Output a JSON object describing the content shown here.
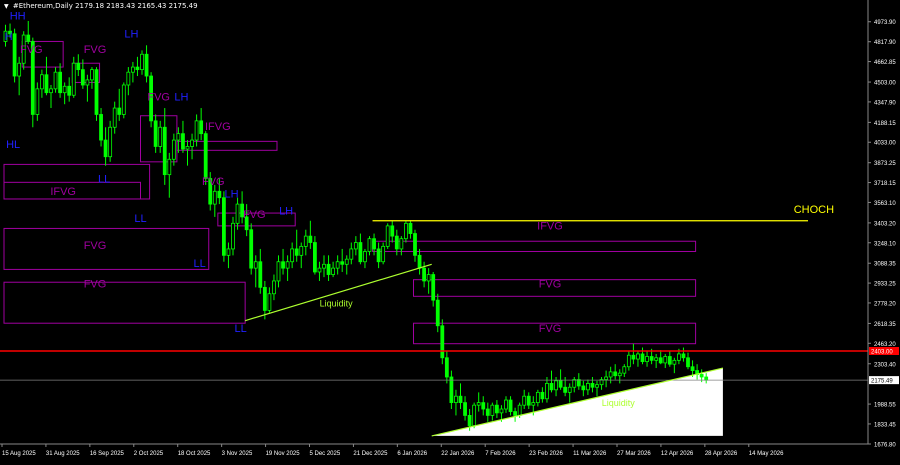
{
  "window": {
    "symbol_label": "#Ethereum,Daily",
    "ohlc_label": "2179.18 2183.43 2165.43 2175.49",
    "dropdown_icon": "triangle-down-icon"
  },
  "colors": {
    "background": "#000000",
    "bull_candle": "#00ff00",
    "bear_candle": "#00ff00",
    "zone_border": "#a000a0",
    "zone_label": "#a000a0",
    "structure_label": "#2020ff",
    "liquidity_line": "#adff2f",
    "choch_color": "#ffff00",
    "key_level": "#ff0000",
    "current_price_line": "#808080",
    "axis_text": "#ffffff"
  },
  "chart_data": {
    "type": "candlestick",
    "title": "#Ethereum,Daily",
    "ylim": [
      1676.8,
      5050
    ],
    "x_ticks": [
      "15 Aug 2025",
      "31 Aug 2025",
      "16 Sep 2025",
      "2 Oct 2025",
      "18 Oct 2025",
      "3 Nov 2025",
      "19 Nov 2025",
      "5 Dec 2025",
      "21 Dec 2025",
      "6 Jan 2026",
      "22 Jan 2026",
      "7 Feb 2026",
      "23 Feb 2026",
      "11 Mar 2026",
      "27 Mar 2026",
      "12 Apr 2026",
      "28 Apr 2026",
      "14 May 2026"
    ],
    "y_ticks": [
      "4973.90",
      "4817.90",
      "4662.85",
      "4503.00",
      "4347.90",
      "4188.15",
      "4033.00",
      "3873.25",
      "3718.15",
      "3563.10",
      "3403.20",
      "3248.10",
      "3088.35",
      "2933.25",
      "2778.20",
      "2618.35",
      "2463.20",
      "2303.40",
      "1988.55",
      "1833.45",
      "1676.80"
    ],
    "current_price": "2175.49",
    "key_level_price": "2403.00",
    "key_level_label": "2403.00",
    "series": [
      {
        "values": [
          [
            4820,
            4950,
            4780,
            4900
          ],
          [
            4900,
            4960,
            4850,
            4880
          ],
          [
            4880,
            4920,
            4500,
            4550
          ],
          [
            4550,
            4700,
            4400,
            4650
          ],
          [
            4650,
            4900,
            4600,
            4870
          ],
          [
            4870,
            4980,
            4800,
            4820
          ],
          [
            4820,
            4850,
            4150,
            4250
          ],
          [
            4250,
            4500,
            4200,
            4450
          ],
          [
            4450,
            4600,
            4380,
            4560
          ],
          [
            4560,
            4700,
            4400,
            4420
          ],
          [
            4420,
            4480,
            4300,
            4450
          ],
          [
            4450,
            4620,
            4420,
            4580
          ],
          [
            4580,
            4650,
            4380,
            4420
          ],
          [
            4420,
            4500,
            4330,
            4470
          ],
          [
            4470,
            4540,
            4350,
            4400
          ],
          [
            4400,
            4700,
            4380,
            4650
          ],
          [
            4650,
            4720,
            4550,
            4600
          ],
          [
            4600,
            4680,
            4450,
            4480
          ],
          [
            4480,
            4560,
            4350,
            4520
          ],
          [
            4520,
            4620,
            4450,
            4600
          ],
          [
            4600,
            4620,
            4200,
            4250
          ],
          [
            4250,
            4300,
            4000,
            4050
          ],
          [
            4050,
            4150,
            3850,
            3920
          ],
          [
            3920,
            4200,
            3880,
            4150
          ],
          [
            4150,
            4350,
            4100,
            4300
          ],
          [
            4300,
            4450,
            4200,
            4250
          ],
          [
            4250,
            4500,
            4220,
            4480
          ],
          [
            4480,
            4620,
            4400,
            4580
          ],
          [
            4580,
            4660,
            4500,
            4620
          ],
          [
            4620,
            4700,
            4550,
            4600
          ],
          [
            4600,
            4750,
            4560,
            4720
          ],
          [
            4720,
            4790,
            4500,
            4550
          ],
          [
            4550,
            4580,
            4150,
            4200
          ],
          [
            4200,
            4250,
            3950,
            4000
          ],
          [
            4000,
            4200,
            3950,
            4150
          ],
          [
            4150,
            4300,
            3700,
            3780
          ],
          [
            3780,
            3950,
            3600,
            3900
          ],
          [
            3900,
            4100,
            3850,
            4050
          ],
          [
            4050,
            4150,
            3950,
            4100
          ],
          [
            4100,
            4200,
            3950,
            3980
          ],
          [
            3980,
            4050,
            3850,
            4000
          ],
          [
            4000,
            4100,
            3900,
            4050
          ],
          [
            4050,
            4250,
            4000,
            4200
          ],
          [
            4200,
            4300,
            4050,
            4100
          ],
          [
            4100,
            4120,
            3700,
            3750
          ],
          [
            3750,
            3800,
            3500,
            3550
          ],
          [
            3550,
            3700,
            3450,
            3650
          ],
          [
            3650,
            3750,
            3550,
            3600
          ],
          [
            3600,
            3650,
            3100,
            3150
          ],
          [
            3150,
            3250,
            3050,
            3200
          ],
          [
            3200,
            3450,
            3150,
            3400
          ],
          [
            3400,
            3600,
            3350,
            3550
          ],
          [
            3550,
            3650,
            3400,
            3450
          ],
          [
            3450,
            3550,
            3300,
            3350
          ],
          [
            3350,
            3400,
            3000,
            3050
          ],
          [
            3050,
            3150,
            2900,
            3100
          ],
          [
            3100,
            3200,
            2850,
            2900
          ],
          [
            2900,
            2950,
            2650,
            2720
          ],
          [
            2720,
            2900,
            2700,
            2850
          ],
          [
            2850,
            3000,
            2800,
            2950
          ],
          [
            2950,
            3150,
            2900,
            3100
          ],
          [
            3100,
            3200,
            3000,
            3050
          ],
          [
            3050,
            3150,
            2950,
            3100
          ],
          [
            3100,
            3250,
            3050,
            3200
          ],
          [
            3200,
            3350,
            3100,
            3150
          ],
          [
            3150,
            3250,
            3050,
            3220
          ],
          [
            3220,
            3350,
            3150,
            3300
          ],
          [
            3300,
            3420,
            3200,
            3250
          ],
          [
            3250,
            3300,
            3000,
            3020
          ],
          [
            3020,
            3100,
            2950,
            3050
          ],
          [
            3050,
            3150,
            2980,
            3080
          ],
          [
            3080,
            3150,
            2950,
            3000
          ],
          [
            3000,
            3100,
            2980,
            3050
          ],
          [
            3050,
            3150,
            3000,
            3100
          ],
          [
            3100,
            3200,
            3020,
            3080
          ],
          [
            3080,
            3150,
            3000,
            3120
          ],
          [
            3120,
            3250,
            3080,
            3200
          ],
          [
            3200,
            3300,
            3150,
            3250
          ],
          [
            3250,
            3320,
            3080,
            3100
          ],
          [
            3100,
            3200,
            3050,
            3180
          ],
          [
            3180,
            3300,
            3150,
            3280
          ],
          [
            3280,
            3320,
            3150,
            3200
          ],
          [
            3200,
            3250,
            3050,
            3100
          ],
          [
            3100,
            3250,
            3080,
            3220
          ],
          [
            3220,
            3400,
            3200,
            3380
          ],
          [
            3380,
            3420,
            3250,
            3300
          ],
          [
            3300,
            3350,
            3150,
            3200
          ],
          [
            3200,
            3300,
            3150,
            3280
          ],
          [
            3280,
            3420,
            3250,
            3400
          ],
          [
            3400,
            3420,
            3280,
            3320
          ],
          [
            3320,
            3350,
            3100,
            3150
          ],
          [
            3150,
            3200,
            3000,
            3050
          ],
          [
            3050,
            3100,
            2900,
            2950
          ],
          [
            2950,
            3050,
            2850,
            3000
          ],
          [
            3000,
            3020,
            2750,
            2800
          ],
          [
            2800,
            2850,
            2550,
            2600
          ],
          [
            2600,
            2650,
            2300,
            2350
          ],
          [
            2350,
            2400,
            2150,
            2200
          ],
          [
            2200,
            2250,
            1950,
            2000
          ],
          [
            2000,
            2100,
            1900,
            2050
          ],
          [
            2050,
            2150,
            1950,
            2000
          ],
          [
            2000,
            2050,
            1860,
            1900
          ],
          [
            1900,
            1950,
            1780,
            1820
          ],
          [
            1820,
            2000,
            1800,
            1980
          ],
          [
            1980,
            2080,
            1930,
            2000
          ],
          [
            2000,
            2050,
            1900,
            1950
          ],
          [
            1950,
            2000,
            1850,
            1900
          ],
          [
            1900,
            2000,
            1860,
            1980
          ],
          [
            1980,
            2020,
            1880,
            1920
          ],
          [
            1920,
            1980,
            1850,
            1950
          ],
          [
            1950,
            2050,
            1920,
            2020
          ],
          [
            2020,
            2050,
            1900,
            1930
          ],
          [
            1930,
            1960,
            1850,
            1900
          ],
          [
            1900,
            2000,
            1880,
            1980
          ],
          [
            1980,
            2100,
            1950,
            2050
          ],
          [
            2050,
            2080,
            1950,
            1980
          ],
          [
            1980,
            2050,
            1900,
            2000
          ],
          [
            2000,
            2100,
            1970,
            2080
          ],
          [
            2080,
            2120,
            2000,
            2030
          ],
          [
            2030,
            2200,
            2000,
            2150
          ],
          [
            2150,
            2250,
            2080,
            2100
          ],
          [
            2100,
            2200,
            2050,
            2170
          ],
          [
            2170,
            2260,
            2100,
            2120
          ],
          [
            2120,
            2200,
            2050,
            2080
          ],
          [
            2080,
            2150,
            2000,
            2120
          ],
          [
            2120,
            2200,
            2080,
            2180
          ],
          [
            2180,
            2230,
            2100,
            2130
          ],
          [
            2130,
            2170,
            2050,
            2100
          ],
          [
            2100,
            2180,
            2060,
            2150
          ],
          [
            2150,
            2200,
            2080,
            2120
          ],
          [
            2120,
            2170,
            2050,
            2140
          ],
          [
            2140,
            2200,
            2100,
            2180
          ],
          [
            2180,
            2250,
            2120,
            2200
          ],
          [
            2200,
            2280,
            2150,
            2240
          ],
          [
            2240,
            2300,
            2180,
            2210
          ],
          [
            2210,
            2260,
            2150,
            2230
          ],
          [
            2230,
            2300,
            2200,
            2280
          ],
          [
            2280,
            2400,
            2250,
            2370
          ],
          [
            2370,
            2460,
            2300,
            2340
          ],
          [
            2340,
            2400,
            2280,
            2380
          ],
          [
            2380,
            2430,
            2300,
            2320
          ],
          [
            2320,
            2400,
            2280,
            2360
          ],
          [
            2360,
            2420,
            2300,
            2330
          ],
          [
            2330,
            2380,
            2270,
            2350
          ],
          [
            2350,
            2410,
            2300,
            2310
          ],
          [
            2310,
            2380,
            2270,
            2360
          ],
          [
            2360,
            2400,
            2280,
            2300
          ],
          [
            2300,
            2350,
            2230,
            2330
          ],
          [
            2330,
            2420,
            2300,
            2380
          ],
          [
            2380,
            2430,
            2320,
            2350
          ],
          [
            2350,
            2390,
            2260,
            2280
          ],
          [
            2280,
            2330,
            2200,
            2250
          ],
          [
            2250,
            2300,
            2180,
            2220
          ],
          [
            2220,
            2260,
            2160,
            2200
          ],
          [
            2200,
            2230,
            2150,
            2175
          ]
        ]
      }
    ],
    "zones": [
      {
        "label": "FVG",
        "y1": 4620,
        "y2": 4820
      },
      {
        "label": "FVG",
        "y1": 4500,
        "y2": 4650
      },
      {
        "label": "FVG",
        "y1": 3880,
        "y2": 4240
      },
      {
        "label": "IFVG",
        "y1": 3970,
        "y2": 4040
      },
      {
        "label": "FVG",
        "y1": 3590,
        "y2": 3860
      },
      {
        "label": "IFVG",
        "y1": 3590,
        "y2": 3720
      },
      {
        "label": "FVG",
        "y1": 3380,
        "y2": 3480
      },
      {
        "label": "FVG",
        "y1": 3040,
        "y2": 3360
      },
      {
        "label": "FVG",
        "y1": 2620,
        "y2": 2940
      },
      {
        "label": "IFVG",
        "y1": 3180,
        "y2": 3260
      },
      {
        "label": "FVG",
        "y1": 2830,
        "y2": 2960
      },
      {
        "label": "FVG",
        "y1": 2460,
        "y2": 2620
      }
    ],
    "labels": [
      "HH",
      "FVG",
      "FVG",
      "LH",
      "FVG",
      "LH",
      "IFVG",
      "HL",
      "LL",
      "IFVG",
      "FVG",
      "LH",
      "LL",
      "FVG",
      "LH",
      "FVG",
      "LL",
      "FVG",
      "LL",
      "Liquidity",
      "IFVG",
      "FVG",
      "FVG",
      "CHOCH",
      "Liquidity",
      "H"
    ]
  }
}
